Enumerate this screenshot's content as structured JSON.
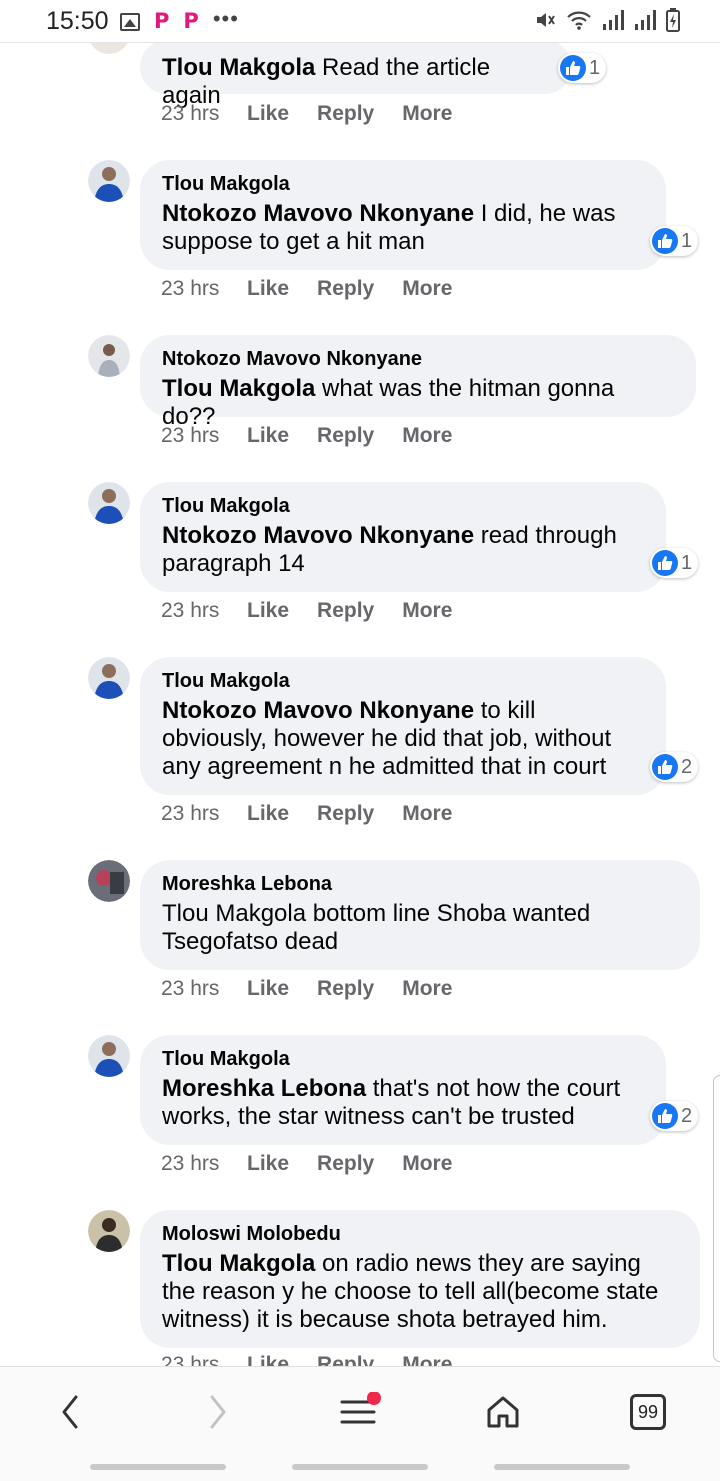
{
  "status_bar": {
    "time": "15:50"
  },
  "comments": [
    {
      "author": "",
      "mention": "Tlou Makgola",
      "text": "Read the article again",
      "likes": "1",
      "time": "23 hrs"
    },
    {
      "author": "Tlou Makgola",
      "mention": "Ntokozo Mavovo Nkonyane",
      "text": "I did, he was suppose to get a hit man",
      "likes": "1",
      "time": "23 hrs"
    },
    {
      "author": "Ntokozo Mavovo Nkonyane",
      "mention": "Tlou Makgola",
      "text": "what was the hitman gonna do??",
      "likes": "",
      "time": "23 hrs"
    },
    {
      "author": "Tlou Makgola",
      "mention": "Ntokozo Mavovo Nkonyane",
      "text": "read through paragraph 14",
      "likes": "1",
      "time": "23 hrs"
    },
    {
      "author": "Tlou Makgola",
      "mention": "Ntokozo Mavovo Nkonyane",
      "text": "to kill obviously, however he did that job, without any agreement n he admitted that in court",
      "likes": "2",
      "time": "23 hrs"
    },
    {
      "author": "Moreshka Lebona",
      "mention": "",
      "text": "Tlou Makgola bottom line Shoba wanted Tsegofatso dead",
      "likes": "",
      "time": "23 hrs"
    },
    {
      "author": "Tlou Makgola",
      "mention": "Moreshka Lebona",
      "text": "that's not how the court works, the star witness can't be trusted",
      "likes": "2",
      "time": "23 hrs"
    },
    {
      "author": "Moloswi Molobedu",
      "mention": "Tlou Makgola",
      "text": "on radio news they are saying the reason y he choose to tell all(become state witness) it is because shota betrayed him.",
      "likes": "",
      "time": "23 hrs"
    }
  ],
  "actions": {
    "like": "Like",
    "reply": "Reply",
    "more": "More"
  },
  "bottom_nav": {
    "tabs_count": "99"
  },
  "colors": {
    "bubble": "#f0f2f5",
    "like_blue": "#1877f2",
    "meta_gray": "#65676b",
    "notif_red": "#f02849"
  }
}
